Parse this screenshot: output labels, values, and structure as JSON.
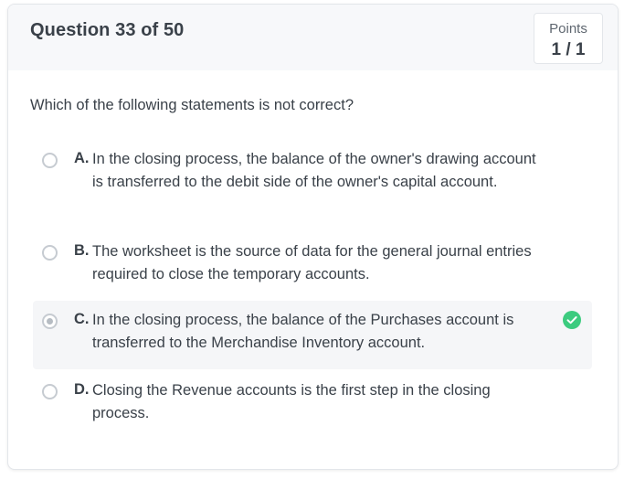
{
  "header": {
    "question_title": "Question 33 of 50",
    "points_label": "Points",
    "points_value": "1 / 1"
  },
  "question": {
    "text": "Which of the following statements is not correct?"
  },
  "options": [
    {
      "letter": "A.",
      "text": "In the closing process, the balance of the owner's drawing account is transferred to the debit side of the owner's capital account.",
      "selected": false,
      "correct": false
    },
    {
      "letter": "B.",
      "text": "The worksheet is the source of data for the general journal entries required to close the temporary accounts.",
      "selected": false,
      "correct": false
    },
    {
      "letter": "C.",
      "text": "In the closing process, the balance of the Purchases account is transferred to the Merchandise Inventory account.",
      "selected": true,
      "correct": true
    },
    {
      "letter": "D.",
      "text": "Closing the Revenue accounts is the first step in the closing process.",
      "selected": false,
      "correct": false
    }
  ],
  "icons": {
    "correct_indicator": "check-circle-icon"
  },
  "colors": {
    "correct_green": "#3ccb7f",
    "header_bg": "#f7f8fa",
    "selected_bg": "#f5f6f8"
  }
}
